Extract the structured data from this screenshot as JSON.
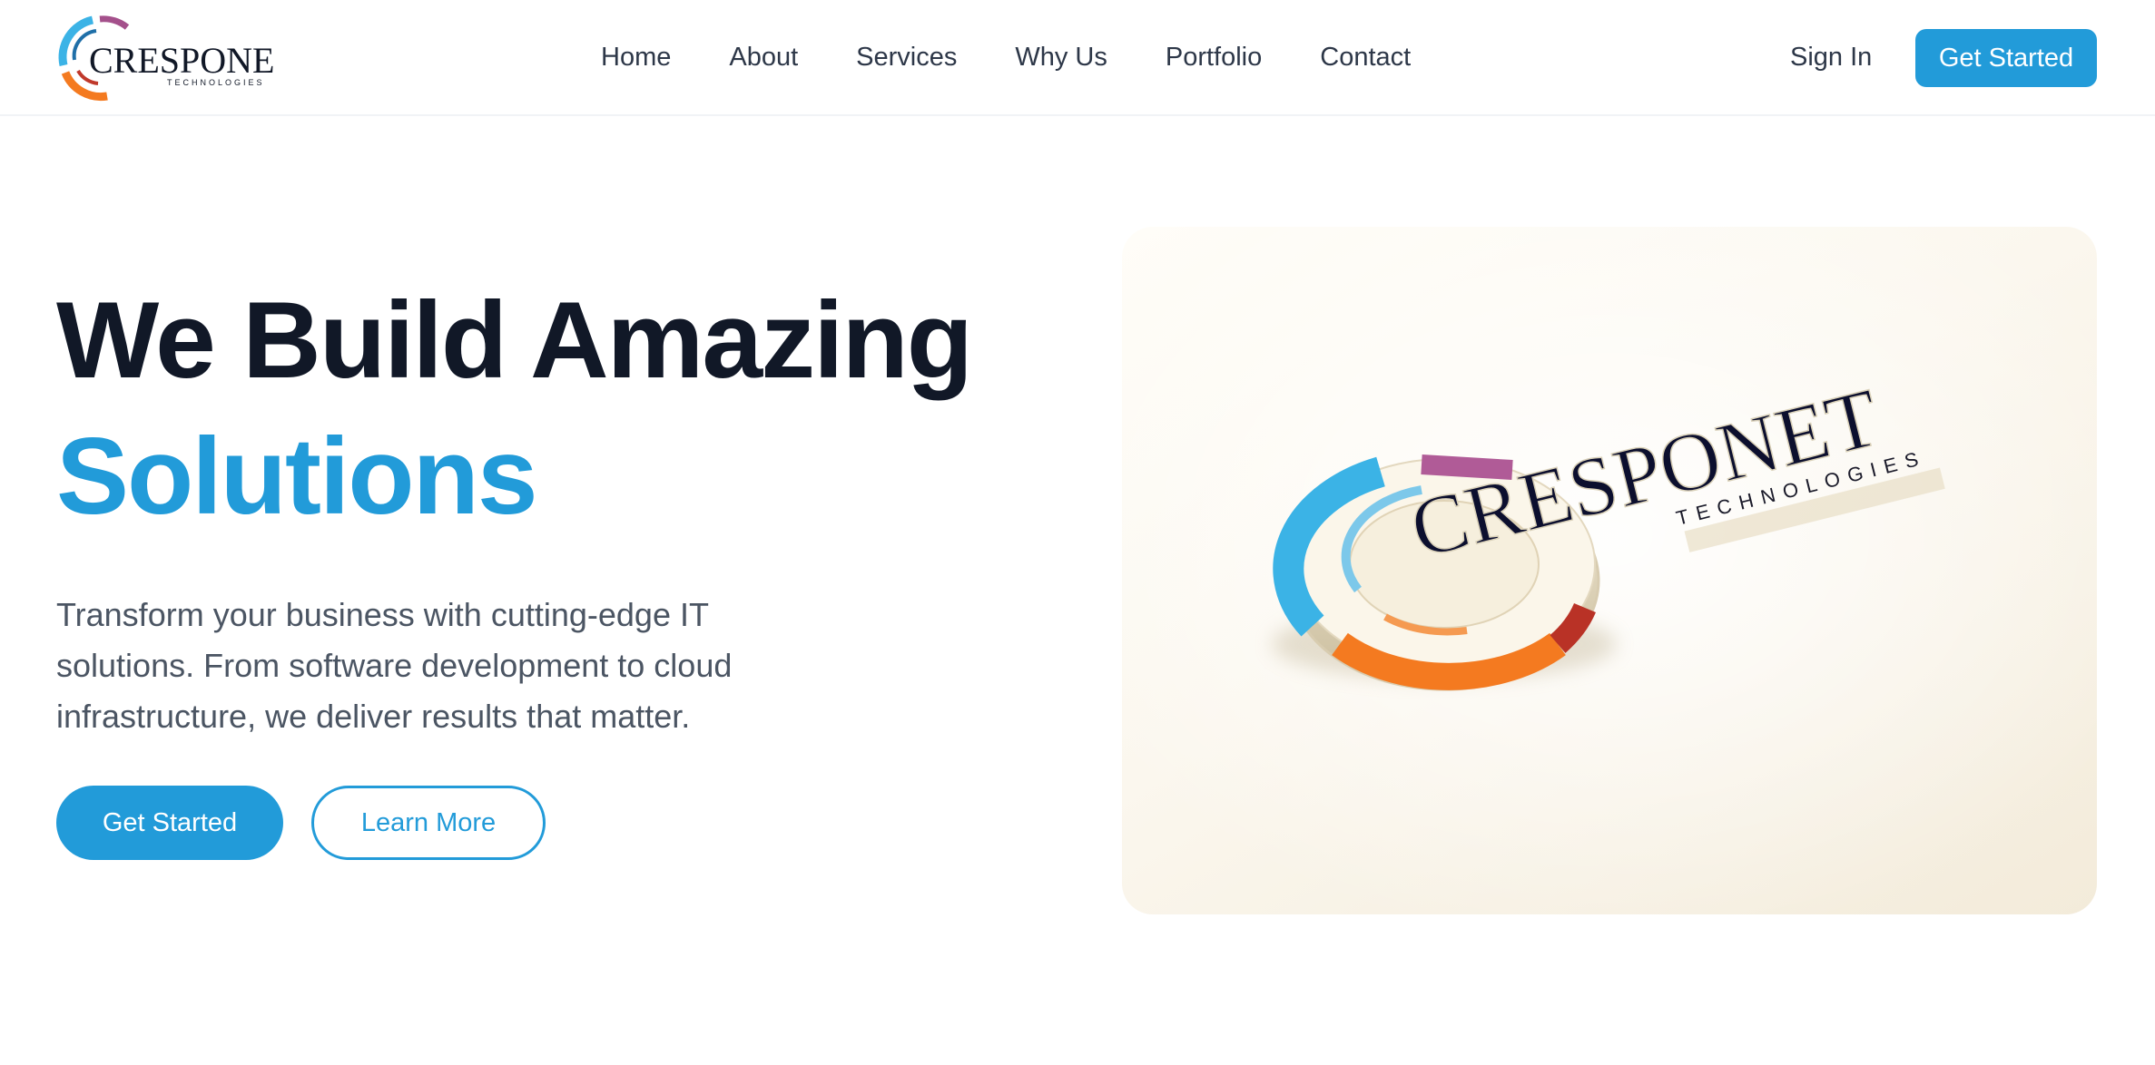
{
  "brand": {
    "name": "CRESPONET",
    "tagline": "TECHNOLOGIES",
    "colors": {
      "accent": "#229bd9",
      "heading": "#111827",
      "body_text": "#4b5563",
      "logo_blue": "#3bb3e6",
      "logo_orange": "#f47a20",
      "logo_red": "#c0392b",
      "logo_purple": "#a4508b"
    }
  },
  "nav": {
    "items": [
      "Home",
      "About",
      "Services",
      "Why Us",
      "Portfolio",
      "Contact"
    ],
    "sign_in": "Sign In",
    "cta": "Get Started"
  },
  "hero": {
    "title_line1": "We Build Amazing",
    "title_line2": "Solutions",
    "description": "Transform your business with cutting-edge IT solutions. From software development to cloud infrastructure, we deliver results that matter.",
    "primary_button": "Get Started",
    "secondary_button": "Learn More"
  }
}
